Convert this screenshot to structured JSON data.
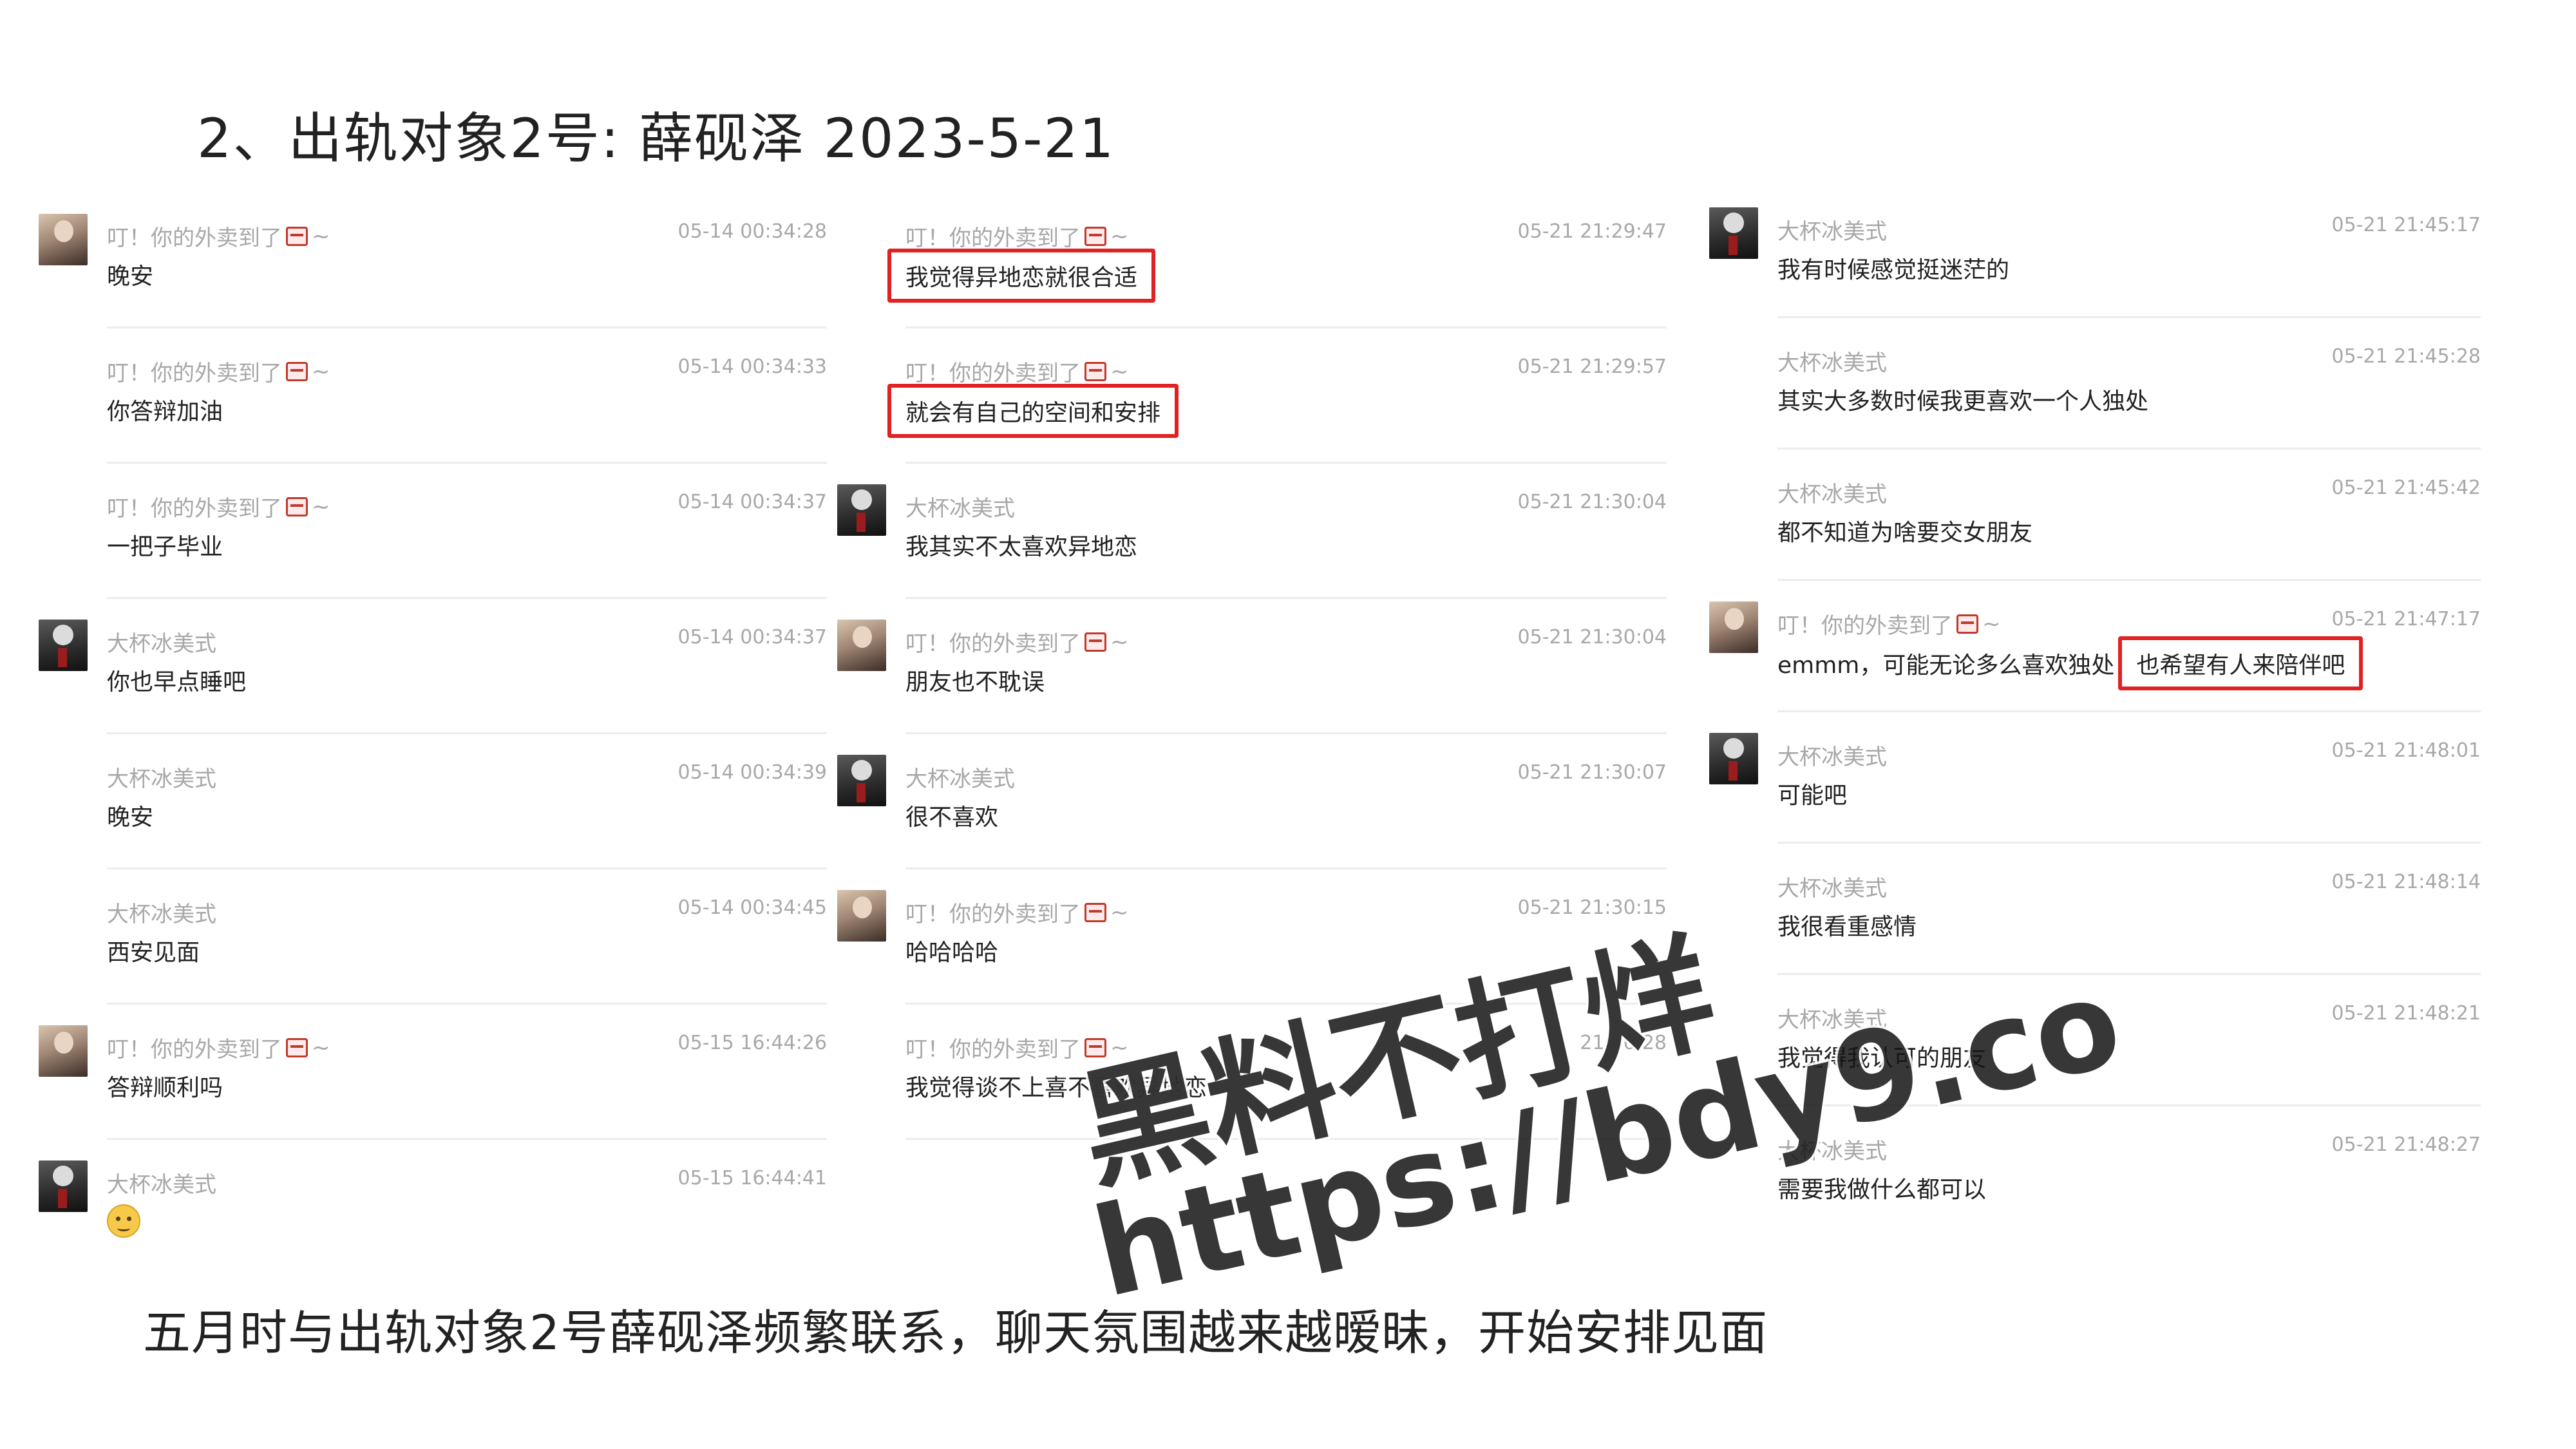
{
  "page": {
    "title": "2、出轨对象2号:  薛砚泽 2023-5-21",
    "caption": "五月时与出轨对象2号薛砚泽频繁联系，聊天氛围越来越暧昧，开始安排见面"
  },
  "watermark": {
    "line1": "黑料不打烊",
    "line2": "https://bdy9.co"
  },
  "icons": {
    "store_bag": "takeout-bag-icon",
    "emoji": "smile-emoji-icon"
  },
  "colors": {
    "highlight_border": "#e02222",
    "name_gray": "#a8a8a8"
  },
  "columns": [
    {
      "messages": [
        {
          "avatar": "girl",
          "name": "叮！你的外卖到了",
          "tilde": "~",
          "time": "05-14 00:34:28",
          "text": "晚安"
        },
        {
          "avatar": "none",
          "name": "叮！你的外卖到了",
          "tilde": "~",
          "time": "05-14 00:34:33",
          "text": "你答辩加油"
        },
        {
          "avatar": "none",
          "name": "叮！你的外卖到了",
          "tilde": "~",
          "time": "05-14 00:34:37",
          "text": "一把子毕业"
        },
        {
          "avatar": "boy",
          "name": "大杯冰美式",
          "time": "05-14 00:34:37",
          "text": "你也早点睡吧"
        },
        {
          "avatar": "none",
          "name": "大杯冰美式",
          "time": "05-14 00:34:39",
          "text": "晚安"
        },
        {
          "avatar": "none",
          "name": "大杯冰美式",
          "time": "05-14 00:34:45",
          "text": "西安见面"
        },
        {
          "avatar": "girl",
          "name": "叮！你的外卖到了",
          "tilde": "~",
          "time": "05-15 16:44:26",
          "text": "答辩顺利吗"
        },
        {
          "avatar": "boy",
          "name": "大杯冰美式",
          "time": "05-15 16:44:41",
          "text": ""
        }
      ]
    },
    {
      "messages": [
        {
          "avatar": "none",
          "name": "叮！你的外卖到了",
          "tilde": "~",
          "time": "05-21 21:29:47",
          "text": "我觉得异地恋就很合适"
        },
        {
          "avatar": "none",
          "name": "叮！你的外卖到了",
          "tilde": "~",
          "time": "05-21 21:29:57",
          "text": "就会有自己的空间和安排"
        },
        {
          "avatar": "boy",
          "name": "大杯冰美式",
          "time": "05-21 21:30:04",
          "text": "我其实不太喜欢异地恋"
        },
        {
          "avatar": "girl",
          "name": "叮！你的外卖到了",
          "tilde": "~",
          "time": "05-21 21:30:04",
          "text": "朋友也不耽误"
        },
        {
          "avatar": "boy",
          "name": "大杯冰美式",
          "time": "05-21 21:30:07",
          "text": "很不喜欢"
        },
        {
          "avatar": "girl",
          "name": "叮！你的外卖到了",
          "tilde": "~",
          "time": "05-21 21:30:15",
          "text": "哈哈哈哈"
        },
        {
          "avatar": "none",
          "name": "叮！你的外卖到了",
          "tilde": "~",
          "time": "21:30:28",
          "text": "我觉得谈不上喜不喜欢异地恋"
        }
      ]
    },
    {
      "messages": [
        {
          "avatar": "boy",
          "name": "大杯冰美式",
          "time": "05-21 21:45:17",
          "text": "我有时候感觉挺迷茫的"
        },
        {
          "avatar": "none",
          "name": "大杯冰美式",
          "time": "05-21 21:45:28",
          "text": "其实大多数时候我更喜欢一个人独处"
        },
        {
          "avatar": "none",
          "name": "大杯冰美式",
          "time": "05-21 21:45:42",
          "text": "都不知道为啥要交女朋友"
        },
        {
          "avatar": "girl",
          "name": "叮！你的外卖到了",
          "tilde": "~",
          "time": "05-21 21:47:17",
          "text": "emmm，可能无论多么喜欢独处",
          "text_highlight": "也希望有人来陪伴吧"
        },
        {
          "avatar": "boy",
          "name": "大杯冰美式",
          "time": "05-21 21:48:01",
          "text": "可能吧"
        },
        {
          "avatar": "none",
          "name": "大杯冰美式",
          "time": "05-21 21:48:14",
          "text": "我很看重感情"
        },
        {
          "avatar": "none",
          "name": "大杯冰美式",
          "time": "05-21 21:48:21",
          "text": "我觉得我认可的朋友"
        },
        {
          "avatar": "none",
          "name": "大杯冰美式",
          "time": "05-21 21:48:27",
          "text": "需要我做什么都可以"
        }
      ]
    }
  ]
}
